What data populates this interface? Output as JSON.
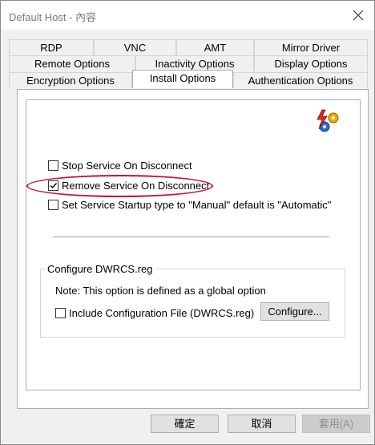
{
  "window": {
    "title": "Default Host - 內容"
  },
  "tabs": {
    "row1": [
      "RDP",
      "VNC",
      "AMT",
      "Mirror Driver"
    ],
    "row2": [
      "Remote Options",
      "Inactivity Options",
      "Display Options"
    ],
    "row3": [
      "Encryption Options",
      "Install Options",
      "Authentication Options"
    ],
    "active": "Install Options"
  },
  "options": {
    "stop_service": {
      "label": "Stop Service On Disconnect",
      "checked": false
    },
    "remove_service": {
      "label": "Remove Service On Disconnect",
      "checked": true
    },
    "startup_type": {
      "label": "Set Service Startup type to \"Manual\"  default is \"Automatic\"",
      "checked": false
    }
  },
  "config_group": {
    "title": "Configure DWRCS.reg",
    "note": "Note: This option is defined as a global option",
    "include_label": "Include Configuration File (DWRCS.reg)",
    "include_checked": false,
    "configure_button": "Configure..."
  },
  "footer": {
    "ok": "確定",
    "cancel": "取消",
    "apply": "套用(A)"
  },
  "colors": {
    "highlight_ellipse": "#c8102e"
  },
  "icons": {
    "corner": "lightning-gear-icon",
    "check": "checkmark-icon",
    "close": "close-icon"
  }
}
